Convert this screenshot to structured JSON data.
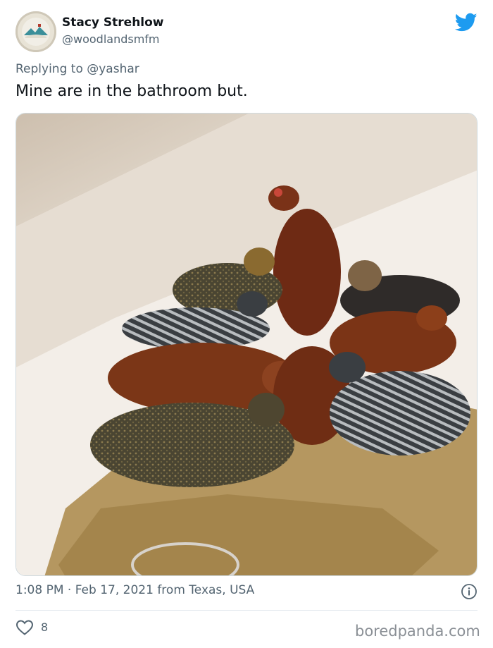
{
  "author": {
    "display_name": "Stacy Strehlow",
    "handle": "@woodlandsmfm",
    "avatar_icon": "avatar-mountain-landscape"
  },
  "reply": {
    "prefix": "Replying to ",
    "mention": "@yashar"
  },
  "tweet": {
    "text": "Mine are in the bathroom but."
  },
  "media": {
    "description_icon": "photo-chickens-in-bathtub"
  },
  "meta": {
    "timestamp_line": "1:08 PM · Feb 17, 2021 from Texas, USA"
  },
  "engagement": {
    "likes": "8"
  },
  "watermark": "boredpanda.com",
  "colors": {
    "twitter_blue": "#1d9bf0",
    "secondary_text": "#536471",
    "primary_text": "#0f1419"
  },
  "icons": {
    "brand": "twitter-bird-icon",
    "info": "info-circle-icon",
    "like": "heart-outline-icon"
  }
}
